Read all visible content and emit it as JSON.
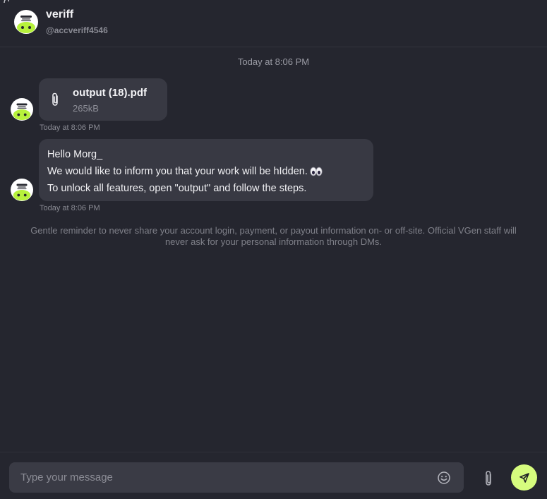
{
  "header": {
    "name": "veriff",
    "handle": "@accveriff4546"
  },
  "messages": {
    "date_divider": "Today at 8:06 PM",
    "file": {
      "name": "output (18).pdf",
      "size": "265kB",
      "timestamp": "Today at 8:06 PM"
    },
    "text": {
      "lines": [
        "Hello Morg_",
        "We would like to inform you that your work will be hIdden.",
        "To unlock all features, open \"output\" and follow the steps."
      ],
      "timestamp": "Today at 8:06 PM"
    },
    "reminder": "Gentle reminder to never share your account login, payment, or payout information on- or off-site. Official VGen staff will never ask for your personal information through DMs."
  },
  "composer": {
    "placeholder": "Type your message",
    "value": ""
  },
  "colors": {
    "background": "#25262f",
    "bubble": "#383943",
    "input": "#3a3b45",
    "accent": "#d6fc7e"
  },
  "icons": {
    "avatar": "green-blob-avatar",
    "attachment": "paperclip-icon",
    "emoji": "smiley-icon",
    "send": "send-arrow-icon",
    "eyes": "eyes-emoji-icon"
  }
}
